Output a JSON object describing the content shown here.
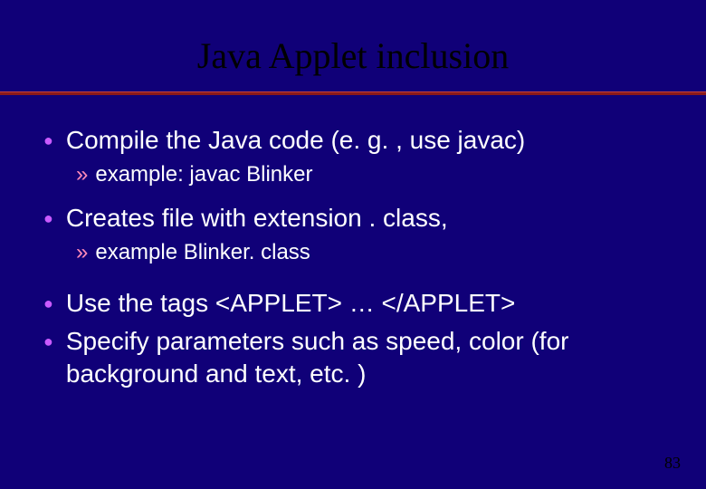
{
  "slide": {
    "title": "Java Applet inclusion",
    "page_number": "83",
    "bullets": [
      {
        "level": 1,
        "text": "Compile the Java code (e. g. , use javac)",
        "sub": {
          "text": "example: javac Blinker"
        }
      },
      {
        "level": 1,
        "text": "Creates file with extension . class,",
        "sub": {
          "text": " example Blinker. class"
        }
      },
      {
        "level": 1,
        "text": "Use the tags <APPLET>  … </APPLET>"
      },
      {
        "level": 1,
        "text": "Specify parameters such as speed, color (for background and text, etc. )"
      }
    ],
    "glyphs": {
      "l1": "●",
      "l2": "»"
    }
  }
}
